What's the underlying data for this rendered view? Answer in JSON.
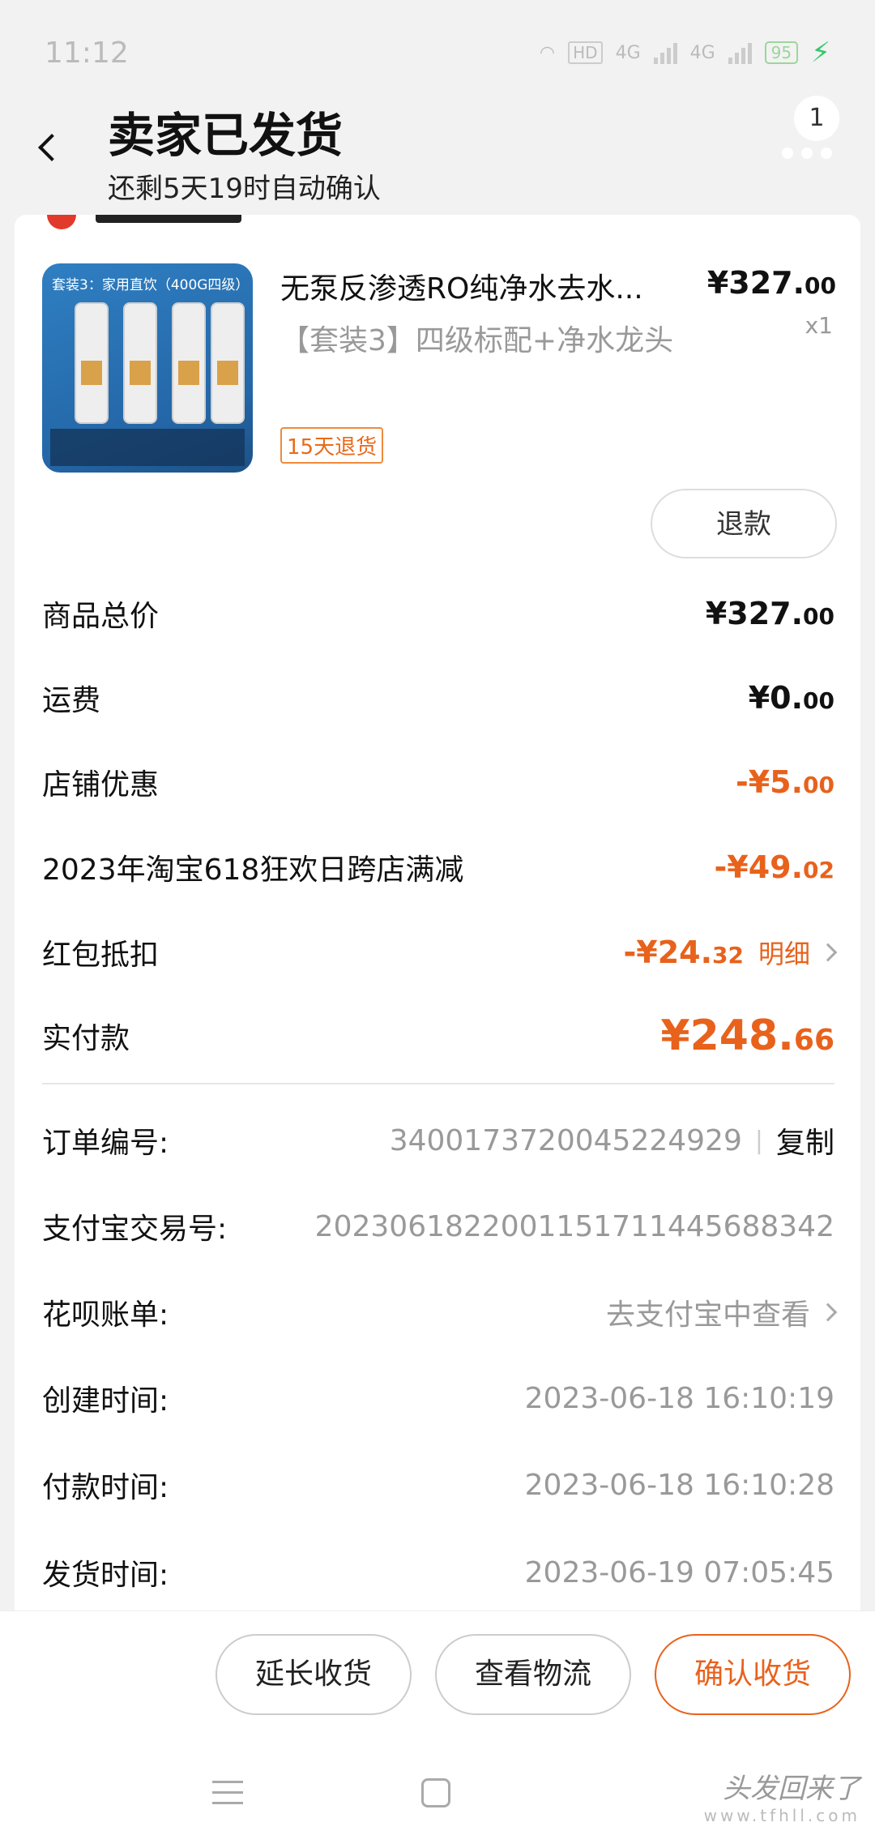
{
  "status_bar": {
    "time": "11:12",
    "hd": "HD",
    "net1": "4G",
    "net2": "4G",
    "battery": "95"
  },
  "header": {
    "title": "卖家已发货",
    "subtitle": "还剩5天19时自动确认",
    "msg_count": "1"
  },
  "product": {
    "thumb_caption": "套装3：家用直饮（400G四级）",
    "title": "无泵反渗透RO纯净水去水...",
    "spec": "【套装3】四级标配+净水龙头",
    "badge": "15天退货",
    "price_int": "¥327.",
    "price_dec": "00",
    "qty": "x1",
    "refund_label": "退款"
  },
  "summary": [
    {
      "label": "商品总价",
      "int": "¥327.",
      "dec": "00"
    },
    {
      "label": "运费",
      "int": "¥0.",
      "dec": "00"
    },
    {
      "label": "店铺优惠",
      "int": "-¥5.",
      "dec": "00"
    },
    {
      "label": "2023年淘宝618狂欢日跨店满减",
      "int": "-¥49.",
      "dec": "02"
    },
    {
      "label": "红包抵扣",
      "int": "-¥24.",
      "dec": "32",
      "link": "明细"
    },
    {
      "label": "实付款",
      "int": "¥248.",
      "dec": "66"
    }
  ],
  "info": [
    {
      "label": "订单编号:",
      "value": "3400173720045224929",
      "sep": "|",
      "action": "复制"
    },
    {
      "label": "支付宝交易号:",
      "value": "2023061822001151711445688342"
    },
    {
      "label": "花呗账单:",
      "value": "去支付宝中查看"
    },
    {
      "label": "创建时间:",
      "value": "2023-06-18 16:10:19"
    },
    {
      "label": "付款时间:",
      "value": "2023-06-18 16:10:28"
    },
    {
      "label": "发货时间:",
      "value": "2023-06-19 07:05:45"
    }
  ],
  "actions": {
    "extend": "延长收货",
    "logistics": "查看物流",
    "confirm": "确认收货"
  },
  "watermark": {
    "text": "头发回来了",
    "url": "www.tfhll.com"
  },
  "colors": {
    "accent": "#e8621c",
    "muted": "#999999"
  }
}
